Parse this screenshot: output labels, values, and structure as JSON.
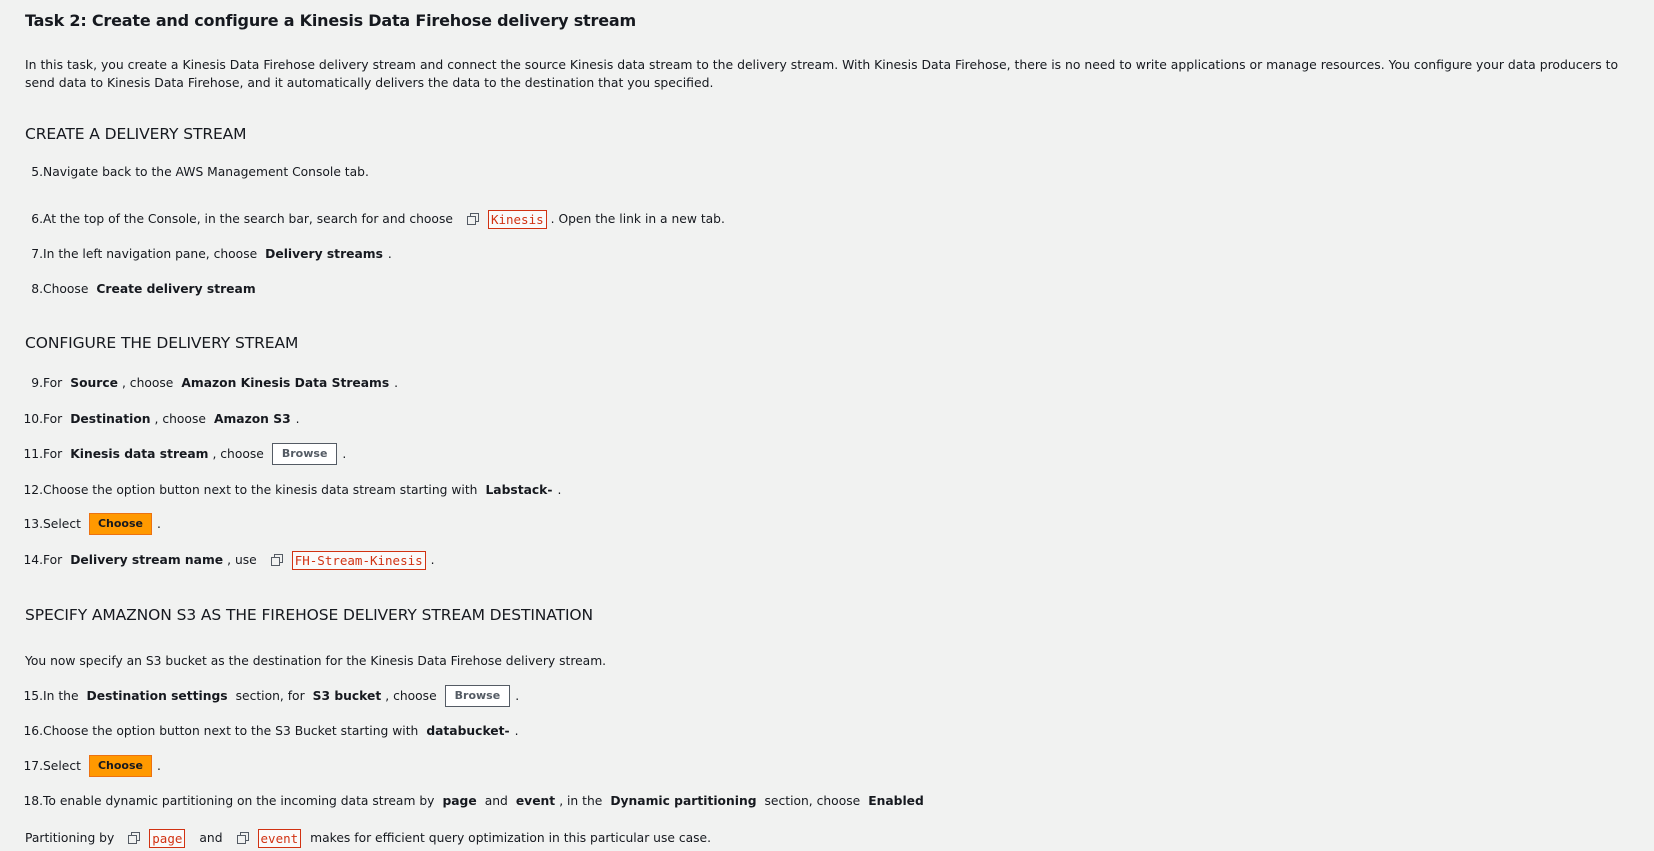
{
  "title": "Task 2: Create and configure a Kinesis Data Firehose delivery stream",
  "intro": "In this task, you create a Kinesis Data Firehose delivery stream and connect the source Kinesis data stream to the delivery stream. With Kinesis Data Firehose, there is no need to write applications or manage resources. You configure your data producers to send data to Kinesis Data Firehose, and it automatically delivers the data to the destination that you specified.",
  "sections": {
    "create": "CREATE A DELIVERY STREAM",
    "configure": "CONFIGURE THE DELIVERY STREAM",
    "specify": "SPECIFY AMAZNON S3 AS THE FIREHOSE DELIVERY STREAM DESTINATION"
  },
  "steps": {
    "s5": {
      "num": "5.",
      "text": "Navigate back to the AWS Management Console tab."
    },
    "s6": {
      "num": "6.",
      "pre": "At the top of the Console, in the search bar, search for and choose",
      "code": "Kinesis",
      "post": ". Open the link in a new tab."
    },
    "s7": {
      "num": "7.",
      "pre": "In the left navigation pane, choose",
      "bold": "Delivery streams",
      "post": "."
    },
    "s8": {
      "num": "8.",
      "pre": "Choose",
      "bold": "Create delivery stream"
    },
    "s9": {
      "num": "9.",
      "pre": "For",
      "bold1": "Source",
      "mid": ", choose",
      "bold2": "Amazon Kinesis Data Streams",
      "post": "."
    },
    "s10": {
      "num": "10.",
      "pre": "For",
      "bold1": "Destination",
      "mid": ", choose",
      "bold2": "Amazon S3",
      "post": "."
    },
    "s11": {
      "num": "11.",
      "pre": "For",
      "bold1": "Kinesis data stream",
      "mid": ", choose",
      "button": "Browse",
      "post": "."
    },
    "s12": {
      "num": "12.",
      "pre": "Choose the option button next to the kinesis data stream starting with",
      "bold": "Labstack-",
      "post": "."
    },
    "s13": {
      "num": "13.",
      "pre": "Select",
      "button": "Choose",
      "post": "."
    },
    "s14": {
      "num": "14.",
      "pre": "For",
      "bold": "Delivery stream name",
      "mid": ", use",
      "code": "FH-Stream-Kinesis",
      "post": "."
    },
    "s15": {
      "num": "15.",
      "pre": "In the",
      "bold1": "Destination settings",
      "mid1": "section, for",
      "bold2": "S3 bucket",
      "mid2": ", choose",
      "button": "Browse",
      "post": "."
    },
    "s16": {
      "num": "16.",
      "pre": "Choose the option button next to the S3 Bucket starting with",
      "bold": "databucket-",
      "post": "."
    },
    "s17": {
      "num": "17.",
      "pre": "Select",
      "button": "Choose",
      "post": "."
    },
    "s18": {
      "num": "18.",
      "pre": "To enable dynamic partitioning on the incoming data stream by",
      "bold1": "page",
      "mid1": "and",
      "bold2": "event",
      "mid2": ", in the",
      "bold3": "Dynamic partitioning",
      "mid3": "section, choose",
      "bold4": "Enabled"
    }
  },
  "specify_note": "You now specify an S3 bucket as the destination for the Kinesis Data Firehose delivery stream.",
  "partition_note": {
    "pre": "Partitioning by",
    "code1": "page",
    "mid": "and",
    "code2": "event",
    "post": "makes for efficient query optimization in this particular use case."
  },
  "colors": {
    "background": "#f1f2f1",
    "code": "#d13212",
    "orange_button": "#ff9900"
  },
  "icons": {
    "copy": "copy-icon"
  }
}
